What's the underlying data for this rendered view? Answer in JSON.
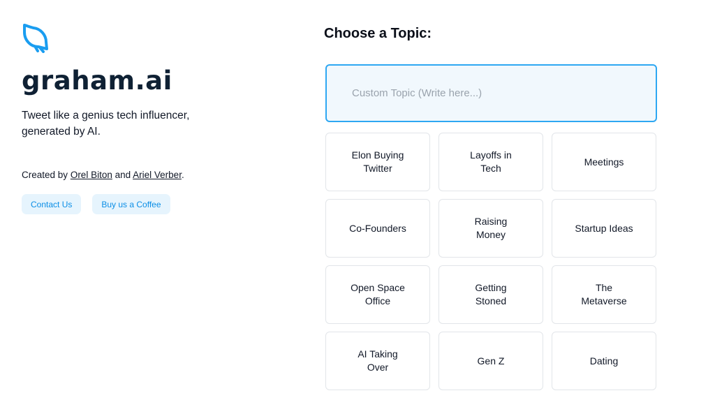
{
  "brand": {
    "name": "graham.ai",
    "logo_icon": "bird-icon",
    "accent": "#1a9df0"
  },
  "tagline": "Tweet like a genius tech influencer, generated by AI.",
  "credits": {
    "prefix": "Created by",
    "author1": "Orel Biton",
    "joiner": "and",
    "author2": "Ariel Verber",
    "suffix": "."
  },
  "buttons": {
    "contact": "Contact Us",
    "coffee": "Buy us a Coffee"
  },
  "main": {
    "title": "Choose a Topic:",
    "custom_placeholder": "Custom Topic (Write here...)",
    "topics": [
      "Elon Buying Twitter",
      "Layoffs in Tech",
      "Meetings",
      "Co-Founders",
      "Raising Money",
      "Startup Ideas",
      "Open Space Office",
      "Getting Stoned",
      "The Metaverse",
      "AI Taking Over",
      "Gen Z",
      "Dating"
    ]
  }
}
